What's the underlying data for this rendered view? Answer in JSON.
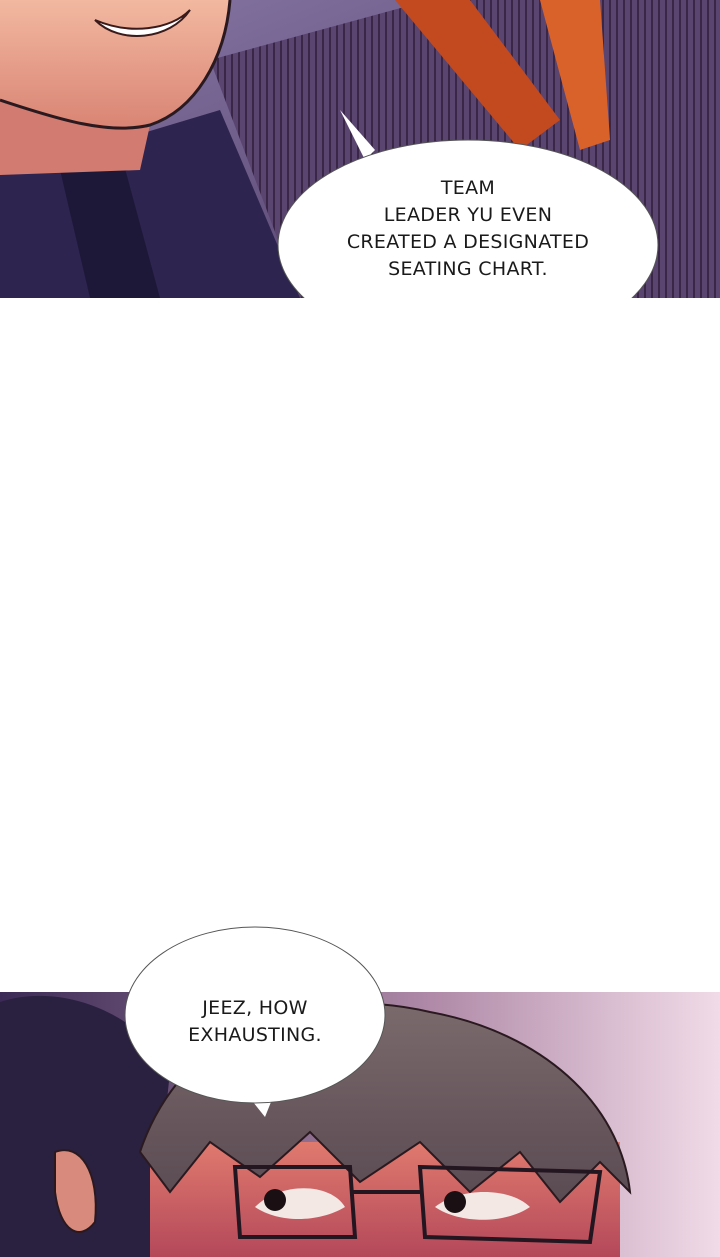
{
  "comic": {
    "panel_top": {
      "speech_bubble": {
        "text": "TEAM\nLEADER YU EVEN\nCREATED A DESIGNATED\nSEATING CHART."
      }
    },
    "panel_bottom": {
      "speech_bubble": {
        "text": "JEEZ, HOW\nEXHAUSTING."
      }
    }
  }
}
